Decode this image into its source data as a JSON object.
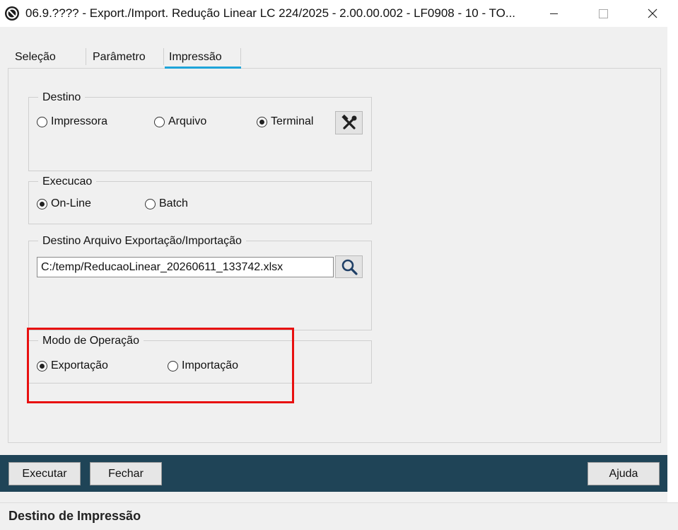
{
  "window": {
    "title": "06.9.???? - Export./Import. Redução Linear LC 224/2025 - 2.00.00.002 - LF0908 - 10 - TO..."
  },
  "tabs": [
    {
      "label": "Seleção",
      "active": false
    },
    {
      "label": "Parâmetro",
      "active": false
    },
    {
      "label": "Impressão",
      "active": true
    }
  ],
  "destino": {
    "legend": "Destino",
    "options": [
      {
        "label": "Impressora",
        "selected": false
      },
      {
        "label": "Arquivo",
        "selected": false
      },
      {
        "label": "Terminal",
        "selected": true
      }
    ],
    "settings_icon": "tools-icon"
  },
  "execucao": {
    "legend": "Execucao",
    "options": [
      {
        "label": "On-Line",
        "selected": true
      },
      {
        "label": "Batch",
        "selected": false
      }
    ]
  },
  "destino_arquivo": {
    "legend": "Destino Arquivo Exportação/Importação",
    "path": "C:/temp/ReducaoLinear_20260611_133742.xlsx",
    "browse_icon": "search-icon"
  },
  "modo_operacao": {
    "legend": "Modo de Operação",
    "options": [
      {
        "label": "Exportação",
        "selected": true
      },
      {
        "label": "Importação",
        "selected": false
      }
    ]
  },
  "footer": {
    "executar": "Executar",
    "fechar": "Fechar",
    "ajuda": "Ajuda"
  },
  "status": {
    "text": "Destino de Impressão"
  },
  "colors": {
    "tab_accent": "#1ea4d9",
    "footer_bg": "#1f4457",
    "highlight": "#e81010"
  }
}
